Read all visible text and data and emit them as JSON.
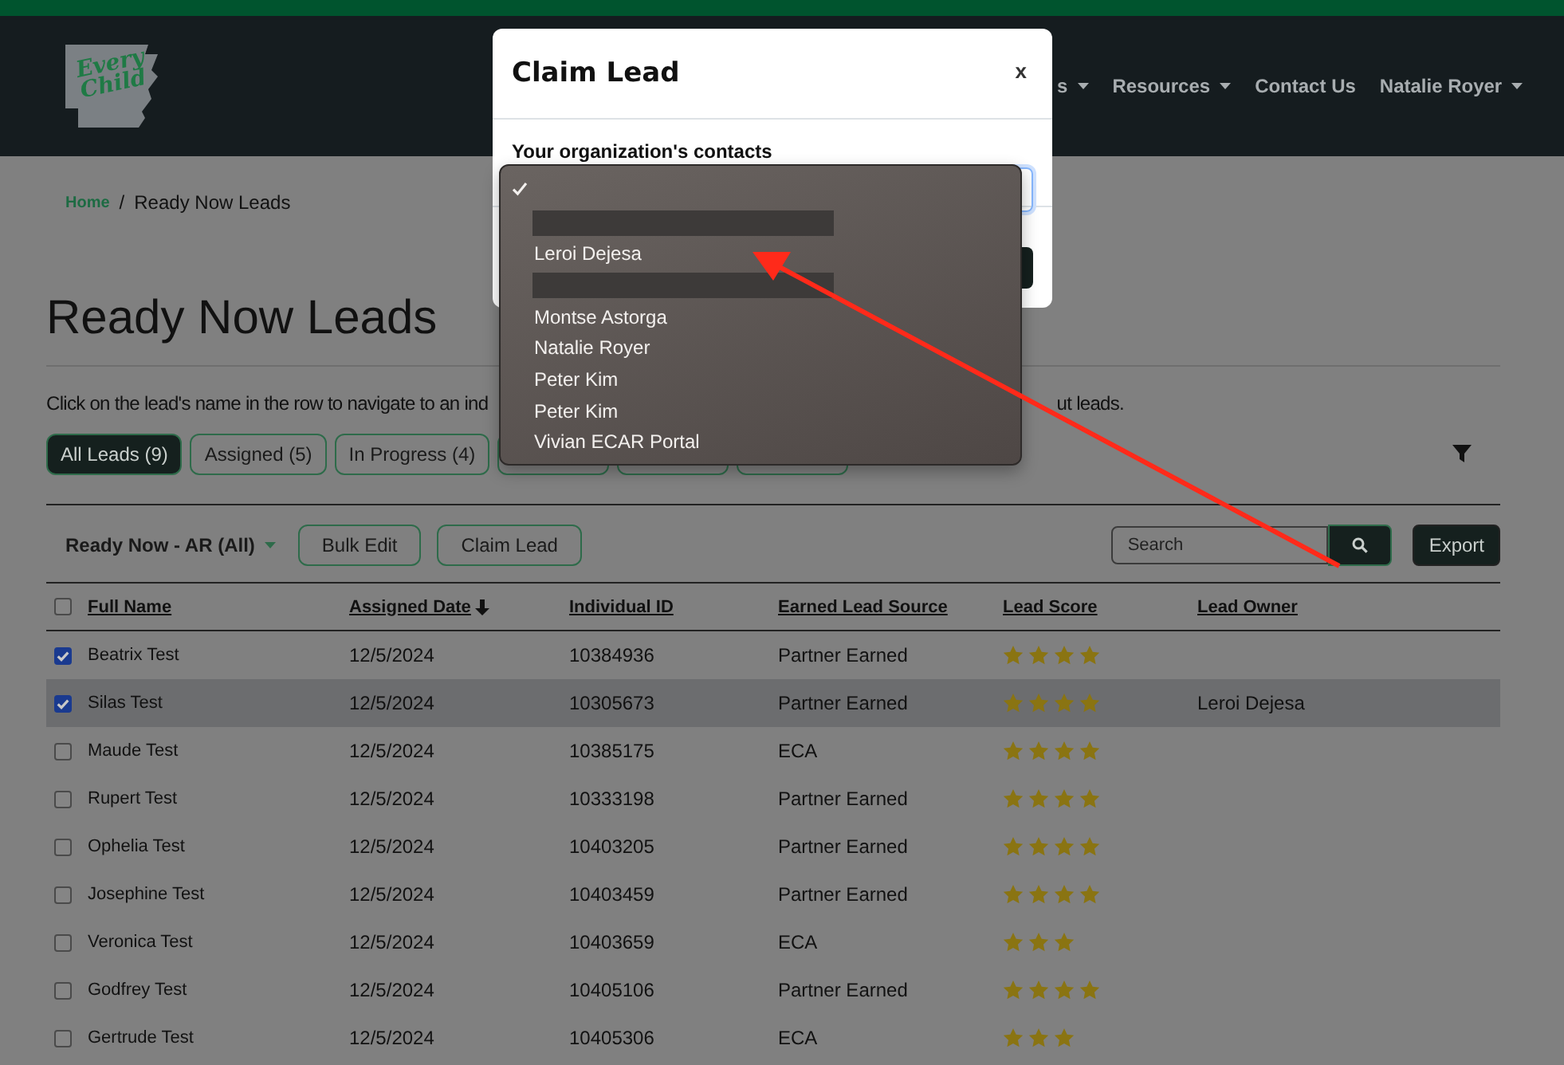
{
  "header": {
    "logo": {
      "line1": "Every",
      "line2": "Child"
    },
    "nav": [
      {
        "label": "s",
        "caret": true
      },
      {
        "label": "Resources",
        "caret": true
      },
      {
        "label": "Contact Us",
        "caret": false
      },
      {
        "label": "Natalie Royer",
        "caret": true
      }
    ]
  },
  "breadcrumb": [
    {
      "label": "Home",
      "kind": "link"
    },
    {
      "label": "Ready Now Leads",
      "kind": "current"
    }
  ],
  "breadcrumb_separator": "/",
  "page_title": "Ready Now Leads",
  "description_visible_parts": [
    "Click on the lead's name in the row to navigate to an ind",
    "ut leads."
  ],
  "tabs": [
    {
      "label": "All Leads (9)",
      "selected": true
    },
    {
      "label": "Assigned (5)",
      "selected": false
    },
    {
      "label": "In Progress (4)",
      "selected": false
    },
    {
      "selected": false
    },
    {
      "selected": false
    },
    {
      "selected": false
    }
  ],
  "toolbar": {
    "view_menu": "Ready Now - AR (All)",
    "buttons": [
      "Bulk Edit",
      "Claim Lead"
    ],
    "search": {
      "placeholder": "Search"
    },
    "export": "Export"
  },
  "table": {
    "select_all": {
      "checked": false
    },
    "columns": [
      {
        "label": "Full Name",
        "sorted_descending": false
      },
      {
        "label": "Assigned Date",
        "sorted_descending": true
      },
      {
        "label": "Individual ID",
        "sorted_descending": false
      },
      {
        "label": "Earned Lead Source",
        "sorted_descending": false
      },
      {
        "label": "Lead Score",
        "sorted_descending": false
      },
      {
        "label": "Lead Owner",
        "sorted_descending": false
      }
    ],
    "rows": [
      {
        "checked": true,
        "selected": false,
        "name": "Beatrix Test",
        "date": "12/5/2024",
        "id": "10384936",
        "source": "Partner Earned",
        "stars": 4
      },
      {
        "checked": true,
        "selected": true,
        "name": "Silas Test",
        "date": "12/5/2024",
        "id": "10305673",
        "source": "Partner Earned",
        "stars": 4,
        "owner": "Leroi Dejesa"
      },
      {
        "checked": false,
        "selected": false,
        "name": "Maude Test",
        "date": "12/5/2024",
        "id": "10385175",
        "source": "ECA",
        "stars": 4
      },
      {
        "checked": false,
        "selected": false,
        "name": "Rupert Test",
        "date": "12/5/2024",
        "id": "10333198",
        "source": "Partner Earned",
        "stars": 4
      },
      {
        "checked": false,
        "selected": false,
        "name": "Ophelia Test",
        "date": "12/5/2024",
        "id": "10403205",
        "source": "Partner Earned",
        "stars": 4
      },
      {
        "checked": false,
        "selected": false,
        "name": "Josephine Test",
        "date": "12/5/2024",
        "id": "10403459",
        "source": "Partner Earned",
        "stars": 4
      },
      {
        "checked": false,
        "selected": false,
        "name": "Veronica Test",
        "date": "12/5/2024",
        "id": "10403659",
        "source": "ECA",
        "stars": 3
      },
      {
        "checked": false,
        "selected": false,
        "name": "Godfrey Test",
        "date": "12/5/2024",
        "id": "10405106",
        "source": "Partner Earned",
        "stars": 4
      },
      {
        "checked": false,
        "selected": false,
        "name": "Gertrude Test",
        "date": "12/5/2024",
        "id": "10405306",
        "source": "ECA",
        "stars": 3
      }
    ]
  },
  "modal": {
    "title": "Claim Lead",
    "close": "x",
    "field_label": "Your organization's contacts",
    "dropdown_options": [
      {
        "kind": "option",
        "selected": true
      },
      {
        "kind": "redacted"
      },
      {
        "kind": "option",
        "label": "Leroi Dejesa",
        "selected": false
      },
      {
        "kind": "redacted"
      },
      {
        "kind": "option",
        "label": "Montse Astorga",
        "selected": false
      },
      {
        "kind": "option",
        "label": "Natalie Royer",
        "selected": false
      },
      {
        "kind": "option",
        "label": "Peter Kim",
        "selected": false
      },
      {
        "kind": "option",
        "label": "Peter Kim",
        "selected": false
      },
      {
        "kind": "option",
        "label": "Vivian ECAR Portal",
        "selected": false
      }
    ]
  },
  "annotation": {
    "kind": "arrow",
    "color": "#ff2a1a"
  }
}
